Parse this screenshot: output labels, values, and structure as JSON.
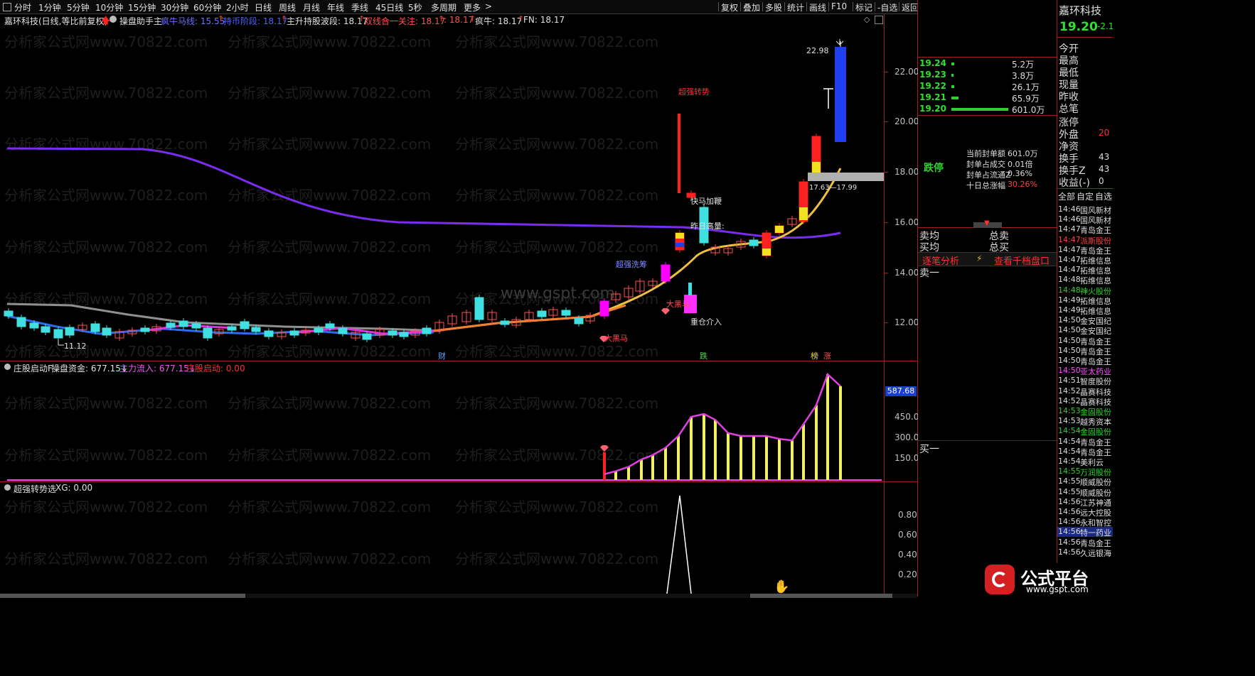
{
  "toolbar": {
    "periods": [
      "分时",
      "1分钟",
      "5分钟",
      "10分钟",
      "15分钟",
      "30分钟",
      "60分钟",
      "2小时",
      "日线",
      "周线",
      "月线",
      "年线",
      "季线",
      "45日线",
      "5秒",
      "多周期",
      "更多"
    ],
    "right_buttons": [
      "复权",
      "叠加",
      "多股",
      "统计",
      "画线",
      "F10",
      "标记",
      "-自选",
      "返回"
    ]
  },
  "header": {
    "stock_title": "嘉环科技(日线,等比前复权)",
    "indicator_name": "操盘助手主",
    "items": [
      {
        "label": "疯牛马线: 15.55",
        "color": "#7070ff"
      },
      {
        "label": "持币阶段: 18.17",
        "color": "#5060ff"
      },
      {
        "label": "主升持股波段: 18.17",
        "color": "#e0e0e0"
      },
      {
        "label": "双线合一关注: 18.17",
        "color": "#ff5050"
      },
      {
        "label": ": 18.17",
        "color": "#ff5050"
      },
      {
        "label": "疯牛: 18.17",
        "color": "#e0e0e0"
      },
      {
        "label": "FN: 18.17",
        "color": "#e0e0e0"
      }
    ]
  },
  "watermark": "分析家公式网www.70822.com",
  "center_watermark": "www.gspt.com",
  "main_axis": [
    "22.00",
    "20.00",
    "18.00",
    "16.00",
    "14.00",
    "12.00"
  ],
  "annotations": {
    "high_price": "22.98",
    "low_price": "11.12",
    "super_strong": "超强转势",
    "fast_horse": "快马加鞭",
    "yesterday_vol": "昨日高量:",
    "strong_wash": "超强洗筹",
    "big_black_horse_1": "大黑马",
    "big_black_horse_2": "大黑马",
    "heavy_enter": "重仓介入",
    "range_label": "17.63—17.99",
    "cai": "财",
    "die": "跌",
    "bang": "榜",
    "zhang": "涨"
  },
  "sub1": {
    "name": "庄股启动F",
    "items": [
      {
        "label": "操盘资金: 677.15↓",
        "color": "#e0e0e0"
      },
      {
        "label": "主力流入: 677.15↓",
        "color": "#ff50ff"
      },
      {
        "label": "庄股启动: 0.00",
        "color": "#ff3030"
      }
    ],
    "axis": [
      "450.0",
      "300.0",
      "150.0"
    ],
    "current_value": "587.68"
  },
  "sub2": {
    "name": "超强转势选",
    "items": [
      {
        "label": "XG: 0.00",
        "color": "#e0e0e0"
      }
    ],
    "axis": [
      "0.80",
      "0.60",
      "0.40",
      "0.20"
    ]
  },
  "right_panel": {
    "stock_name": "嘉环科技",
    "price": "19.20",
    "change": "-2.1",
    "labels_col": [
      "今开",
      "最高",
      "最低",
      "现量",
      "昨收",
      "总笔"
    ],
    "labels_col2": [
      "涨停",
      "外盘",
      "净资",
      "换手",
      "换手Z",
      "收益(-)"
    ],
    "values_col2": [
      "",
      "20",
      "",
      "43",
      "43",
      "0"
    ],
    "bids": [
      {
        "price": "19.24",
        "vol": "5.2万",
        "bar": 4
      },
      {
        "price": "19.23",
        "vol": "3.8万",
        "bar": 3
      },
      {
        "price": "19.22",
        "vol": "26.1万",
        "bar": 4
      },
      {
        "price": "19.21",
        "vol": "65.9万",
        "bar": 10
      },
      {
        "price": "19.20",
        "vol": "601.0万",
        "bar": 80
      }
    ],
    "limit_status": "跌停",
    "info": [
      {
        "label": "当前封单额",
        "value": "601.0万",
        "color": "#ddd"
      },
      {
        "label": "封单占成交",
        "value": "0.01倍",
        "color": "#ddd"
      },
      {
        "label": "封单占流通Z",
        "value": "0.36%",
        "color": "#ddd"
      },
      {
        "label": "十日总涨幅",
        "value": "30.26%",
        "color": "#ff4040"
      }
    ],
    "sell_avg": "卖均",
    "buy_avg": "买均",
    "total_sell": "总卖",
    "total_buy": "总买",
    "tick_analysis": "逐笔分析",
    "view_thousand": "查看千档盘口",
    "sell_one": "卖一",
    "buy_one": "买一"
  },
  "news_tabs": [
    "全部",
    "自定",
    "自选"
  ],
  "news": [
    {
      "time": "14:46",
      "name": "国风新材",
      "color": "#ddd"
    },
    {
      "time": "14:46",
      "name": "国风新材",
      "color": "#ddd"
    },
    {
      "time": "14:47",
      "name": "青岛金王",
      "color": "#ddd"
    },
    {
      "time": "14:47",
      "name": "派斯股份",
      "color": "#ff4040"
    },
    {
      "time": "14:47",
      "name": "青岛金王",
      "color": "#ddd"
    },
    {
      "time": "14:47",
      "name": "拓维信息",
      "color": "#ddd"
    },
    {
      "time": "14:47",
      "name": "拓维信息",
      "color": "#ddd"
    },
    {
      "time": "14:48",
      "name": "拓维信息",
      "color": "#ddd"
    },
    {
      "time": "14:48",
      "name": "神火股份",
      "color": "#30d030"
    },
    {
      "time": "14:49",
      "name": "拓维信息",
      "color": "#ddd"
    },
    {
      "time": "14:49",
      "name": "拓维信息",
      "color": "#ddd"
    },
    {
      "time": "14:50",
      "name": "金安国纪",
      "color": "#ddd"
    },
    {
      "time": "14:50",
      "name": "金安国纪",
      "color": "#ddd"
    },
    {
      "time": "14:50",
      "name": "青岛金王",
      "color": "#ddd"
    },
    {
      "time": "14:50",
      "name": "青岛金王",
      "color": "#ddd"
    },
    {
      "time": "14:50",
      "name": "青岛金王",
      "color": "#ddd"
    },
    {
      "time": "14:50",
      "name": "亚太药业",
      "color": "#ff50ff"
    },
    {
      "time": "14:51",
      "name": "智度股份",
      "color": "#ddd"
    },
    {
      "time": "14:52",
      "name": "晶赛科技",
      "color": "#ddd"
    },
    {
      "time": "14:52",
      "name": "晶赛科技",
      "color": "#ddd"
    },
    {
      "time": "14:53",
      "name": "金固股份",
      "color": "#30d030"
    },
    {
      "time": "14:53",
      "name": "越秀资本",
      "color": "#ddd"
    },
    {
      "time": "14:54",
      "name": "金固股份",
      "color": "#30d030"
    },
    {
      "time": "14:54",
      "name": "青岛金王",
      "color": "#ddd"
    },
    {
      "time": "14:54",
      "name": "青岛金王",
      "color": "#ddd"
    },
    {
      "time": "14:54",
      "name": "美利云",
      "color": "#ddd"
    },
    {
      "time": "14:55",
      "name": "万润股份",
      "color": "#30d030"
    },
    {
      "time": "14:55",
      "name": "顺威股份",
      "color": "#ddd"
    },
    {
      "time": "14:55",
      "name": "顺威股份",
      "color": "#ddd"
    },
    {
      "time": "14:56",
      "name": "江苏神通",
      "color": "#ddd"
    },
    {
      "time": "14:56",
      "name": "远大控股",
      "color": "#ddd"
    },
    {
      "time": "14:56",
      "name": "永和智控",
      "color": "#ddd"
    },
    {
      "time": "14:56",
      "name": "特一药业",
      "color": "#ddd"
    },
    {
      "time": "14:56",
      "name": "青岛金王",
      "color": "#ddd"
    },
    {
      "time": "14:56",
      "name": "久远银海",
      "color": "#ddd"
    }
  ],
  "logo": {
    "text": "公式平台",
    "url": "www.gspt.com"
  }
}
